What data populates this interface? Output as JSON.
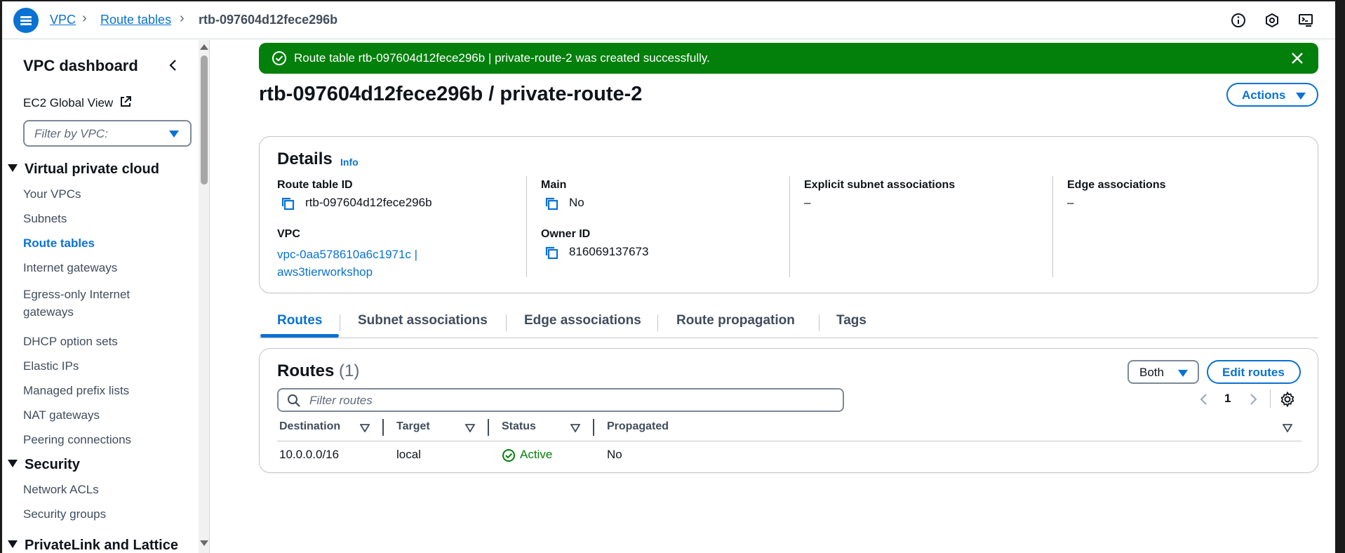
{
  "breadcrumb": {
    "items": [
      "VPC",
      "Route tables"
    ],
    "current": "rtb-097604d12fece296b"
  },
  "topbar": {
    "icons": [
      "info-icon",
      "notification-icon",
      "cloudshell-icon"
    ]
  },
  "sidebar": {
    "title": "VPC dashboard",
    "global_view": "EC2 Global View",
    "filter_placeholder": "Filter by VPC:",
    "sections": [
      {
        "title": "Virtual private cloud",
        "items": [
          "Your VPCs",
          "Subnets",
          "Route tables",
          "Internet gateways",
          "Egress-only Internet",
          "gateways",
          "DHCP option sets",
          "Elastic IPs",
          "Managed prefix lists",
          "NAT gateways",
          "Peering connections"
        ]
      },
      {
        "title": "Security",
        "items": [
          "Network ACLs",
          "Security groups"
        ]
      },
      {
        "title": "PrivateLink and Lattice",
        "items": []
      }
    ],
    "active_item": "Route tables"
  },
  "flash": {
    "message": "Route table rtb-097604d12fece296b | private-route-2 was created successfully.",
    "color": "#037f0c"
  },
  "page": {
    "title": "rtb-097604d12fece296b / private-route-2",
    "actions_label": "Actions"
  },
  "details": {
    "heading": "Details",
    "info": "Info",
    "route_table_id_label": "Route table ID",
    "route_table_id": "rtb-097604d12fece296b",
    "main_label": "Main",
    "main": "No",
    "explicit_label": "Explicit subnet associations",
    "explicit": "–",
    "edge_label": "Edge associations",
    "edge": "–",
    "vpc_label": "VPC",
    "vpc_line1": "vpc-0aa578610a6c1971c |",
    "vpc_line2": "aws3tierworkshop",
    "owner_label": "Owner ID",
    "owner": "816069137673"
  },
  "tabs": [
    "Routes",
    "Subnet associations",
    "Edge associations",
    "Route propagation",
    "Tags"
  ],
  "routes": {
    "title": "Routes",
    "count": "(1)",
    "both_label": "Both",
    "edit_label": "Edit routes",
    "filter_placeholder": "Filter routes",
    "page": "1",
    "columns": [
      "Destination",
      "Target",
      "Status",
      "Propagated"
    ],
    "rows": [
      {
        "destination": "10.0.0.0/16",
        "target": "local",
        "status": "Active",
        "propagated": "No"
      }
    ]
  },
  "colors": {
    "accent": "#0972d3",
    "success": "#037f0c",
    "text": "#0f141a"
  }
}
